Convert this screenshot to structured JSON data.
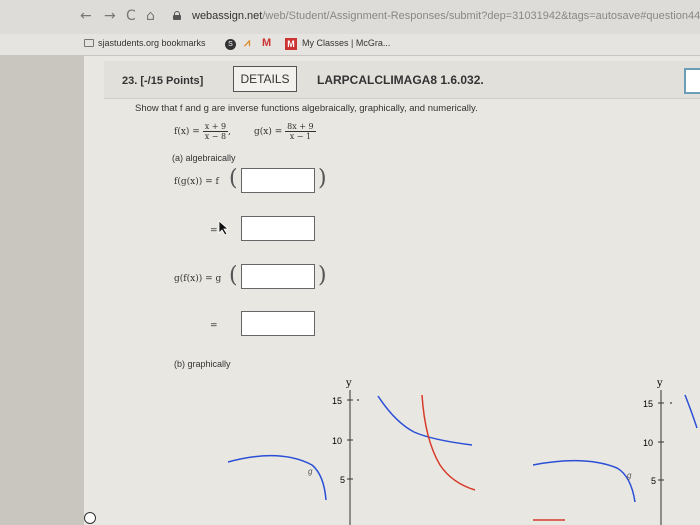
{
  "browser": {
    "nav_back": "←",
    "nav_forward": "→",
    "reload": "C",
    "home": "⌂",
    "url_host": "webassign.net",
    "url_path": "/web/Student/Assignment-Responses/submit?dep=31031942&tags=autosave#question443"
  },
  "bookmarks": {
    "folder_label": "sjastudents.org bookmarks",
    "item_myclasses": "My Classes | McGra..."
  },
  "question": {
    "number": "23.  [-/15 Points]",
    "details_label": "DETAILS",
    "code": "LARPCALCLIMAGA8 1.6.032.",
    "prompt": "Show that f and g are inverse functions algebraically, graphically, and numerically.",
    "f_def": {
      "lhs": "f(x) =",
      "num": "x + 9",
      "den": "x − 8"
    },
    "g_def": {
      "lhs": "g(x) =",
      "num": "8x + 9",
      "den": "x − 1"
    },
    "part_a": "(a) algebraically",
    "fg_lhs": "f(g(x)) = f",
    "gf_lhs": "g(f(x)) = g",
    "equals": "=",
    "part_b": "(b) graphically"
  },
  "graphs": [
    {
      "ylabel": "y",
      "ticks": [
        "15",
        "10",
        "5"
      ],
      "curve_label": "g"
    },
    {
      "ylabel": "y",
      "ticks": [
        "15",
        "10",
        "5"
      ],
      "curve_label": "g"
    }
  ],
  "colors": {
    "f_curve": "#2a4fd6",
    "g_curve": "#d63a2a"
  }
}
